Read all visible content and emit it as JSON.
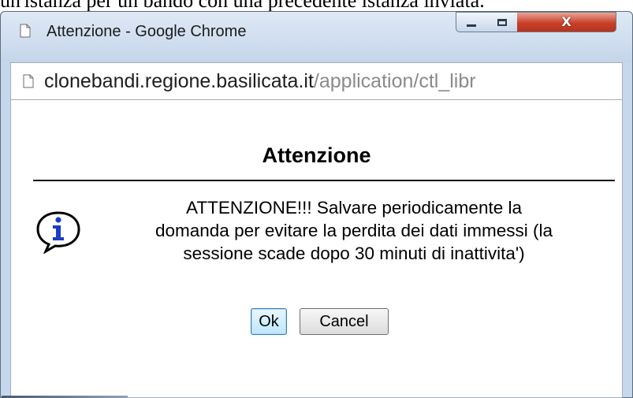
{
  "background": {
    "partial_text": "un'istanza per un bando con una precedente istanza inviata."
  },
  "window": {
    "title": "Attenzione - Google Chrome",
    "controls": {
      "minimize": "minimize",
      "maximize": "maximize",
      "close": "X"
    }
  },
  "addressbar": {
    "host": "clonebandi.regione.basilicata.it",
    "path": "/application/ctl_libr"
  },
  "dialog": {
    "heading": "Attenzione",
    "message_lines": [
      "ATTENZIONE!!! Salvare periodicamente la",
      "domanda per evitare la perdita dei dati immessi (la",
      "sessione scade dopo 30 minuti di inattivita')"
    ],
    "icon": "info-icon",
    "ok_label": "Ok",
    "cancel_label": "Cancel"
  },
  "colors": {
    "window_frame": "#c5d7ec",
    "close_button": "#c7412a",
    "info_icon": "#1a3dc4",
    "url_path": "#8a8a8a"
  }
}
